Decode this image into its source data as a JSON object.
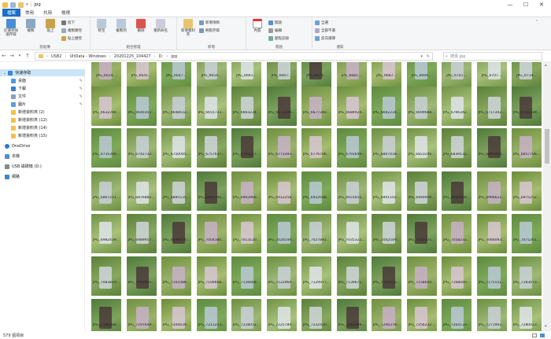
{
  "title": {
    "path": "jpg",
    "minimize": "—",
    "maximize": "☐",
    "close": "✕"
  },
  "tabs": [
    "檔案",
    "常用",
    "共用",
    "檢視"
  ],
  "ribbon": {
    "clipboard": {
      "label": "剪貼簿",
      "pin": "釘選到快速存取",
      "copy": "複製",
      "paste": "貼上",
      "cut": "剪下",
      "copy_path": "複製路徑",
      "paste_shortcut": "貼上捷徑"
    },
    "organize": {
      "label": "組合管理",
      "move": "移至",
      "copy": "複製到",
      "delete": "刪除",
      "rename": "重新命名"
    },
    "new": {
      "label": "新增",
      "folder": "新增資料夾",
      "item": "新增項目",
      "quick": "輕鬆存取"
    },
    "open": {
      "label": "開啟",
      "properties": "內容",
      "open": "開啟",
      "edit": "編輯",
      "history": "歷程記錄"
    },
    "select": {
      "label": "選取",
      "all": "全選",
      "none": "全部不選",
      "invert": "反向選擇"
    }
  },
  "address": {
    "crumbs": [
      "USB2",
      "UltData - Windows",
      "20201225_104427",
      "D:",
      "jpg"
    ],
    "search_placeholder": "搜尋 jpg"
  },
  "nav": {
    "quick_access": "快速存取",
    "items": [
      "桌面",
      "下載",
      "文件",
      "圖片",
      "新增資料夾 (2)",
      "新增資料夾 (12)",
      "新增資料夾 (14)",
      "新增資料夾 (15)"
    ],
    "onedrive": "OneDrive",
    "thispc": "本機",
    "usb": "USB 磁碟機 (D:)",
    "network": "網路"
  },
  "files": {
    "row0": [
      "JPG_6634...",
      "JPG_6641...",
      "JPG_6647...",
      "JPG_6654...",
      "JPG_6661...",
      "JPG_6667...",
      "JPG_6674...",
      "JPG_6681...",
      "JPG_6687...",
      "JPG_6694...",
      "JPG_6701...",
      "JPG_6707...",
      "JPG_6714..."
    ],
    "row1": [
      "JPG_6632294...",
      "JPG_6640353...",
      "JPG_6648432...",
      "JPG_6655733...",
      "JPG_6663234...",
      "JPG_6670243...",
      "JPG_6677340...",
      "JPG_6684924...",
      "JPG_6692234...",
      "JPG_6699688...",
      "JPG_6706342...",
      "JPG_6717342...",
      "JPG_6726339..."
    ],
    "row2": [
      "JPG_6735390...",
      "JPG_6742732...",
      "JPG_6750095...",
      "JPG_6757637...",
      "JPG_6765217...",
      "JPG_6773393...",
      "JPG_6776706...",
      "JPG_6791649...",
      "JPG_6807418...",
      "JPG_6823246...",
      "JPG_6839132...",
      "JPG_6848465...",
      "JPG_6857706..."
    ],
    "row3": [
      "JPG_6867251...",
      "JPG_6876882...",
      "JPG_6885535...",
      "JPG_6893742...",
      "JPG_6902868...",
      "JPG_6912258...",
      "JPG_6922048...",
      "JPG_6931855...",
      "JPG_6941102...",
      "JPG_6949009...",
      "JPG_6958169...",
      "JPG_6966621...",
      "JPG_6975252..."
    ],
    "row4": [
      "JPG_6982439...",
      "JPG_6989957...",
      "JPG_6996974...",
      "JPG_7004380...",
      "JPG_7013120...",
      "JPG_7020549...",
      "JPG_7027891...",
      "JPG_7035322...",
      "JPG_7042549...",
      "JPG_7050771...",
      "JPG_7058232...",
      "JPG_7066093...",
      "JPG_7075261..."
    ],
    "row5": [
      "JPG_7083819...",
      "JPG_7092695...",
      "JPG_7101086...",
      "JPG_7109668...",
      "JPG_7116668...",
      "JPG_7122969...",
      "JPG_7129977...",
      "JPG_7139671...",
      "JPG_7149312...",
      "JPG_7158640...",
      "JPG_7168040...",
      "JPG_7175551...",
      "JPG_7183073..."
    ],
    "row6": [
      "JPG_7196268...",
      "JPG_7197649...",
      "JPG_7204439...",
      "JPG_7211223...",
      "JPG_7218052...",
      "JPG_7225789...",
      "JPG_7232430...",
      "JPG_7240309...",
      "JPG_7246378...",
      "JPG_7256232...",
      "JPG_7264133...",
      "JPG_7271902...",
      "JPG_7280023..."
    ]
  },
  "status": {
    "count": "579 個項目"
  }
}
